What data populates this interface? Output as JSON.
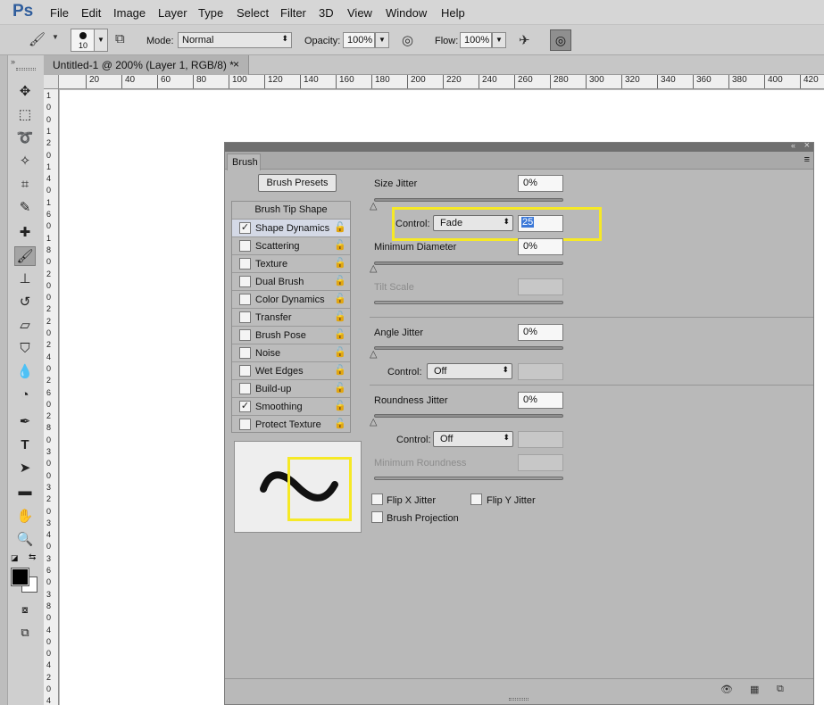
{
  "app": {
    "logo": "Ps"
  },
  "menu": [
    "File",
    "Edit",
    "Image",
    "Layer",
    "Type",
    "Select",
    "Filter",
    "3D",
    "View",
    "Window",
    "Help"
  ],
  "options_bar": {
    "brush_size": "10",
    "mode_label": "Mode:",
    "mode_value": "Normal",
    "opacity_label": "Opacity:",
    "opacity_value": "100%",
    "flow_label": "Flow:",
    "flow_value": "100%"
  },
  "document": {
    "tab_title": "Untitled-1 @ 200% (Layer 1, RGB/8) *",
    "close": "×",
    "ruler_ticks": [
      "20",
      "40",
      "60",
      "80",
      "100",
      "120",
      "140",
      "160",
      "180",
      "200",
      "220",
      "240",
      "260",
      "280",
      "300",
      "320",
      "340",
      "360",
      "380",
      "400",
      "420"
    ],
    "left_ruler": [
      "1",
      "0",
      "0",
      "1",
      "2",
      "0",
      "1",
      "4",
      "0",
      "1",
      "6",
      "0",
      "1",
      "8",
      "0",
      "2",
      "0",
      "0",
      "2",
      "2",
      "0",
      "2",
      "4",
      "0",
      "2",
      "6",
      "0",
      "2",
      "8",
      "0",
      "3",
      "0",
      "0",
      "3",
      "2",
      "0",
      "3",
      "4",
      "0",
      "3",
      "6",
      "0",
      "3",
      "8",
      "0",
      "4",
      "0",
      "0",
      "4",
      "2",
      "0",
      "4"
    ]
  },
  "brush_panel": {
    "tab": "Brush",
    "collapse_icon": "«",
    "close_icon": "×",
    "menu_icon": "≡",
    "presets_button": "Brush Presets",
    "tip_shape_label": "Brush Tip Shape",
    "options": [
      {
        "label": "Shape Dynamics",
        "checked": true,
        "selected": true
      },
      {
        "label": "Scattering",
        "checked": false
      },
      {
        "label": "Texture",
        "checked": false
      },
      {
        "label": "Dual Brush",
        "checked": false
      },
      {
        "label": "Color Dynamics",
        "checked": false
      },
      {
        "label": "Transfer",
        "checked": false
      },
      {
        "label": "Brush Pose",
        "checked": false
      },
      {
        "label": "Noise",
        "checked": false
      },
      {
        "label": "Wet Edges",
        "checked": false
      },
      {
        "label": "Build-up",
        "checked": false
      },
      {
        "label": "Smoothing",
        "checked": true
      },
      {
        "label": "Protect Texture",
        "checked": false
      }
    ],
    "size_jitter": {
      "label": "Size Jitter",
      "value": "0%"
    },
    "size_control": {
      "label": "Control:",
      "value": "Fade",
      "steps": "25"
    },
    "min_diameter": {
      "label": "Minimum Diameter",
      "value": "0%"
    },
    "tilt_scale": {
      "label": "Tilt Scale"
    },
    "angle_jitter": {
      "label": "Angle Jitter",
      "value": "0%"
    },
    "angle_control": {
      "label": "Control:",
      "value": "Off"
    },
    "roundness_jitter": {
      "label": "Roundness Jitter",
      "value": "0%"
    },
    "roundness_control": {
      "label": "Control:",
      "value": "Off"
    },
    "min_roundness": {
      "label": "Minimum Roundness"
    },
    "flip_x": "Flip X Jitter",
    "flip_y": "Flip Y Jitter",
    "projection": "Brush Projection",
    "highlight_color": "#f6e926"
  }
}
